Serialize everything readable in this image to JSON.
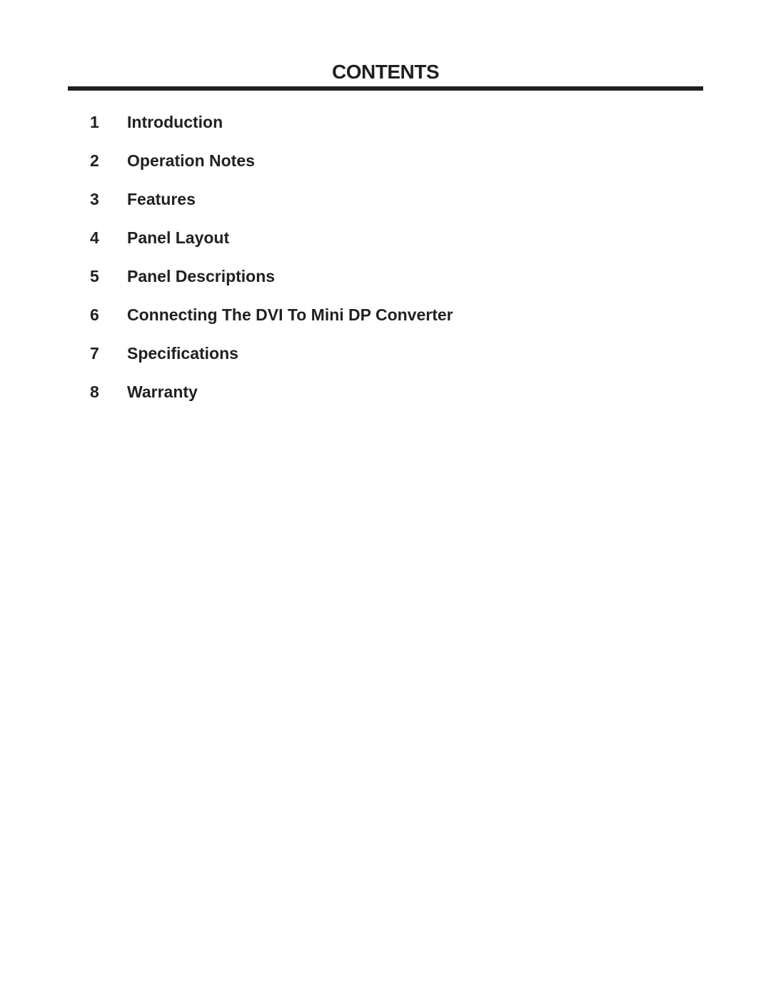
{
  "title": "CONTENTS",
  "toc": [
    {
      "number": "1",
      "label": "Introduction"
    },
    {
      "number": "2",
      "label": "Operation Notes"
    },
    {
      "number": "3",
      "label": "Features"
    },
    {
      "number": "4",
      "label": "Panel Layout"
    },
    {
      "number": "5",
      "label": "Panel Descriptions"
    },
    {
      "number": "6",
      "label": "Connecting The DVI To Mini DP Converter"
    },
    {
      "number": "7",
      "label": "Specifications"
    },
    {
      "number": "8",
      "label": "Warranty"
    }
  ]
}
